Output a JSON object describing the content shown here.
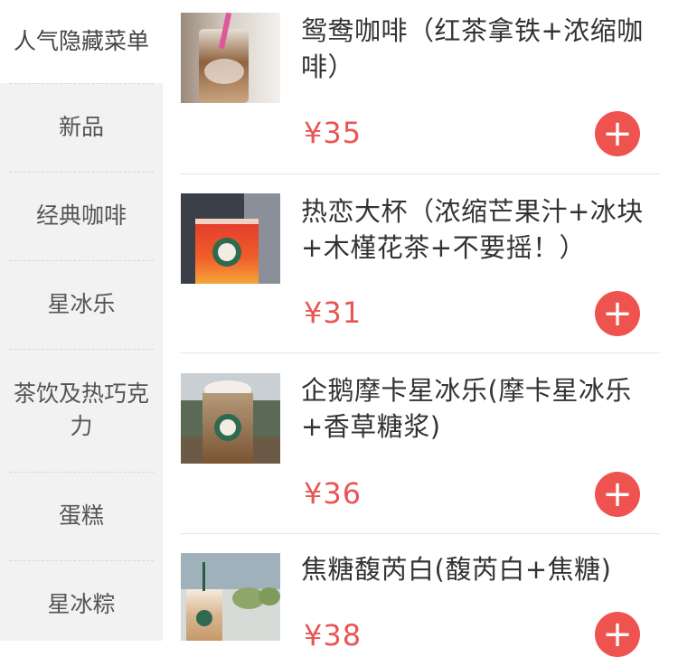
{
  "sidebar": {
    "items": [
      {
        "label": "人气隐藏菜单"
      },
      {
        "label": "新品"
      },
      {
        "label": "经典咖啡"
      },
      {
        "label": "星冰乐"
      },
      {
        "label": "茶饮及热巧克力"
      },
      {
        "label": "蛋糕"
      },
      {
        "label": "星冰粽"
      }
    ]
  },
  "products": [
    {
      "title": "鸳鸯咖啡（红茶拿铁+浓缩咖啡）",
      "price": "¥35"
    },
    {
      "title": "热恋大杯（浓缩芒果汁+冰块+木槿花茶+不要摇！）",
      "price": "¥31"
    },
    {
      "title": "企鹅摩卡星冰乐(摩卡星冰乐+香草糖浆)",
      "price": "¥36"
    },
    {
      "title": "焦糖馥芮白(馥芮白+焦糖)",
      "price": "¥38"
    }
  ],
  "add_button": {
    "glyph": "+"
  },
  "colors": {
    "accent": "#ef5350",
    "price": "#e85555",
    "sidebar_bg": "#f2f2f2"
  }
}
